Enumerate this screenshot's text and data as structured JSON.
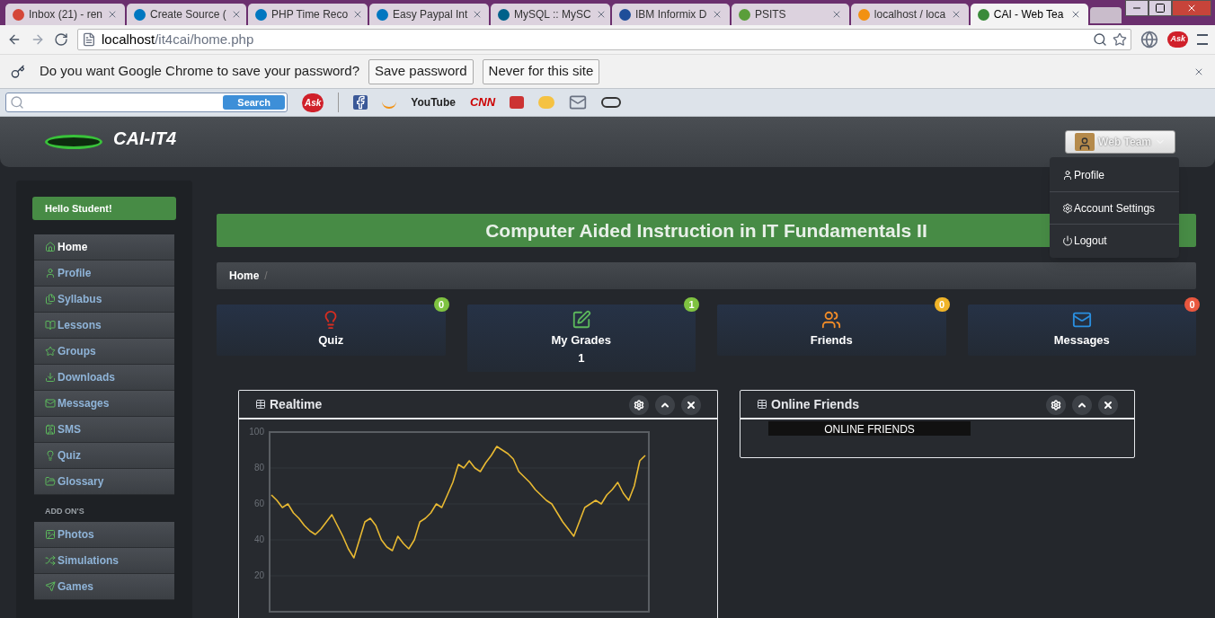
{
  "browser": {
    "tabs": [
      {
        "title": "Inbox (21) - ren",
        "selected": false
      },
      {
        "title": "Create Source (",
        "selected": false
      },
      {
        "title": "PHP Time Reco",
        "selected": false
      },
      {
        "title": "Easy Paypal Int",
        "selected": false
      },
      {
        "title": "MySQL :: MySC",
        "selected": false
      },
      {
        "title": "IBM Informix D",
        "selected": false
      },
      {
        "title": "PSITS",
        "selected": false
      },
      {
        "title": "localhost / loca",
        "selected": false
      },
      {
        "title": "CAI - Web Tea",
        "selected": true
      }
    ],
    "address": {
      "host": "localhost",
      "path": "/it4cai/home.php"
    },
    "address_badge": "Ask",
    "password_bar": {
      "question": "Do you want Google Chrome to save your password?",
      "buttons": [
        "Save password",
        "Never for this site"
      ]
    },
    "toolbar": {
      "search_button": "Search",
      "ask_badge": "Ask",
      "logos": [
        "YouTube",
        "CNN"
      ]
    }
  },
  "header": {
    "brand": "CAI-IT4",
    "user_button": "Web Team"
  },
  "user_menu": [
    "Profile",
    "Account Settings",
    "Logout"
  ],
  "sidebar": {
    "greeting": "Hello Student!",
    "items": [
      {
        "label": "Home",
        "selected": true
      },
      {
        "label": "Profile",
        "selected": false
      },
      {
        "label": "Syllabus",
        "selected": false
      },
      {
        "label": "Lessons",
        "selected": false
      },
      {
        "label": "Groups",
        "selected": false
      },
      {
        "label": "Downloads",
        "selected": false
      },
      {
        "label": "Messages",
        "selected": false
      },
      {
        "label": "SMS",
        "selected": false
      },
      {
        "label": "Quiz",
        "selected": false
      },
      {
        "label": "Glossary",
        "selected": false
      }
    ],
    "addons_heading": "ADD ON'S",
    "addons": [
      {
        "label": "Photos",
        "selected": false
      },
      {
        "label": "Simulations",
        "selected": false
      },
      {
        "label": "Games",
        "selected": false
      }
    ]
  },
  "banner": "Computer Aided Instruction in IT Fundamentals II",
  "breadcrumb": {
    "items": [
      "Home"
    ],
    "separator": "/"
  },
  "stats": [
    {
      "label": "Quiz",
      "count": "0",
      "color": "#7fc241"
    },
    {
      "label": "My Grades",
      "count": "1",
      "color": "#7fc241",
      "value": "1"
    },
    {
      "label": "Friends",
      "count": "0",
      "color": "#f0b429"
    },
    {
      "label": "Messages",
      "count": "0",
      "color": "#e9573f"
    }
  ],
  "realtime_panel": {
    "title": "Realtime",
    "chart_data": {
      "type": "line",
      "ylim": [
        0,
        100
      ],
      "yticks": [
        20,
        40,
        60,
        80,
        100
      ],
      "grid": true,
      "values": [
        65,
        62,
        58,
        60,
        55,
        52,
        48,
        45,
        43,
        46,
        50,
        54,
        48,
        42,
        35,
        30,
        40,
        50,
        52,
        48,
        40,
        36,
        34,
        42,
        38,
        35,
        40,
        50,
        52,
        55,
        60,
        58,
        65,
        72,
        82,
        80,
        84,
        80,
        78,
        83,
        87,
        92,
        90,
        88,
        85,
        78,
        75,
        72,
        68,
        65,
        62,
        60,
        55,
        50,
        46,
        42,
        50,
        58,
        60,
        62,
        60,
        65,
        68,
        72,
        66,
        62,
        70,
        84,
        87
      ]
    }
  },
  "friends_panel": {
    "title": "Online Friends",
    "list_heading": "ONLINE FRIENDS"
  }
}
